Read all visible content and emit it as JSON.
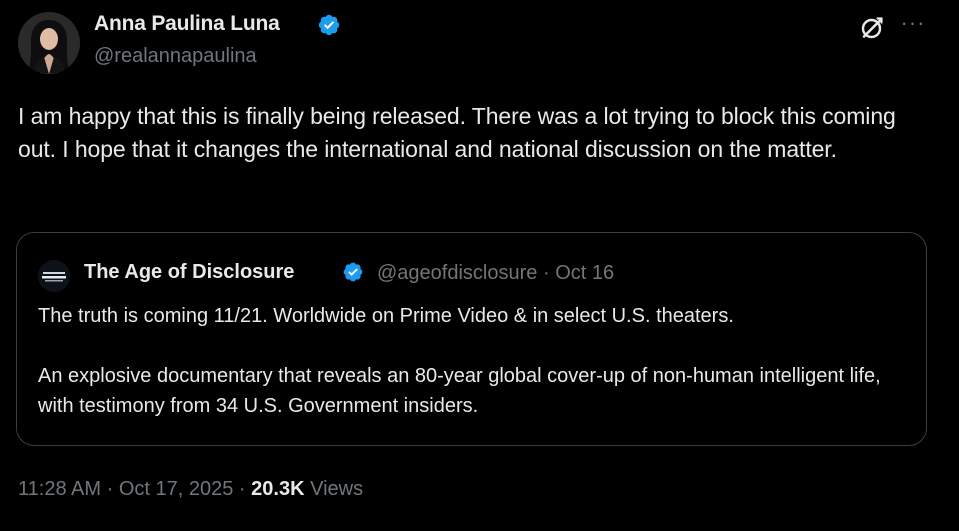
{
  "author": {
    "display_name": "Anna Paulina Luna",
    "handle": "@realannapaulina",
    "verified_color": "#1d9bf0"
  },
  "header_actions": {
    "grok_icon": "grok-icon",
    "more_icon": "more-horizontal-icon",
    "more_glyph": "···"
  },
  "tweet": {
    "text": "I am happy that this is finally being released. There was a lot trying to block this coming out. I hope that it changes the international and national discussion on the matter."
  },
  "quote": {
    "display_name": "The Age of Disclosure",
    "handle": "@ageofdisclosure",
    "separator": "·",
    "date": "Oct 16",
    "paragraph_1": "The truth is coming 11/21. Worldwide on Prime Video & in select U.S. theaters.",
    "paragraph_2": "An explosive documentary that reveals an 80-year global cover-up of non-human intelligent life, with testimony from 34 U.S. Government insiders."
  },
  "footer": {
    "time": "11:28 AM",
    "separator_1": "·",
    "date": "Oct 17, 2025",
    "separator_2": "·",
    "views_count": "20.3K",
    "views_label": "Views"
  }
}
